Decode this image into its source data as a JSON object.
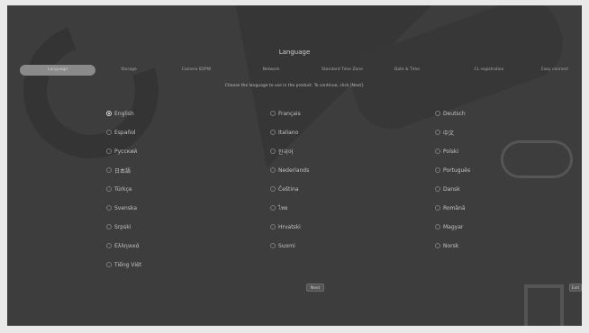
{
  "header": {
    "title": "Language"
  },
  "steps": [
    {
      "label": "Language",
      "active": true
    },
    {
      "label": "Storage",
      "active": false
    },
    {
      "label": "Camera ID/PW",
      "active": false
    },
    {
      "label": "Network",
      "active": false
    },
    {
      "label": "Standard Time Zone",
      "active": false
    },
    {
      "label": "Date & Time",
      "active": false
    },
    {
      "label": "CL registration",
      "active": false
    },
    {
      "label": "Easy connect",
      "active": false
    }
  ],
  "instruction": "Choose the language to use in the product. To continue, click [Next].",
  "languages": {
    "col1": [
      "English",
      "Español",
      "Русский",
      "日本語",
      "Türkçe",
      "Svenska",
      "Srpski",
      "Ελληνικά",
      "Tiếng Việt"
    ],
    "col2": [
      "Français",
      "Italiano",
      "한국어",
      "Nederlands",
      "Čeština",
      "ไทย",
      "Hrvatski",
      "Suomi"
    ],
    "col3": [
      "Deutsch",
      "中文",
      "Polski",
      "Português",
      "Dansk",
      "Română",
      "Magyar",
      "Norsk"
    ]
  },
  "selected_language": "English",
  "buttons": {
    "next": "Next",
    "exit": "Exit"
  }
}
